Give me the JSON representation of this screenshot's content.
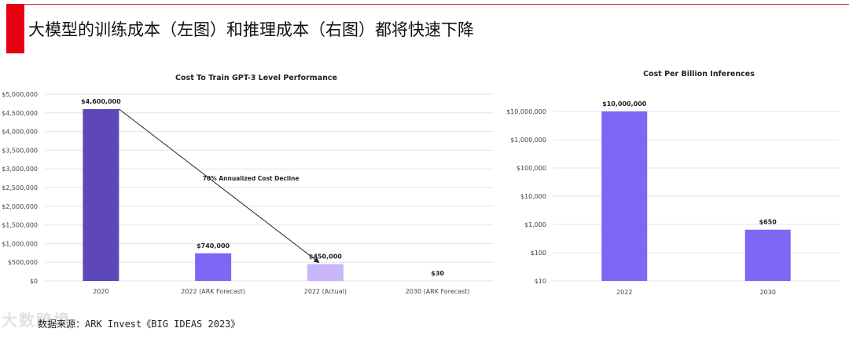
{
  "page": {
    "title": "大模型的训练成本（左图）和推理成本（右图）都将快速下降",
    "source": "数据来源：ARK Invest《BIG IDEAS 2023》",
    "watermark": "大数跨境",
    "colors": {
      "header_red": "#e60012"
    }
  },
  "chart_data": [
    {
      "type": "bar",
      "title": "Cost To Train GPT-3 Level Performance",
      "categories": [
        "2020",
        "2022 (ARK Forecast)",
        "2022 (Actual)",
        "2030 (ARK Forecast)"
      ],
      "values": [
        4600000,
        740000,
        450000,
        30
      ],
      "data_labels": [
        "$4,600,000",
        "$740,000",
        "$450,000",
        "$30"
      ],
      "bar_colors": [
        "#5e47b8",
        "#7f66f5",
        "#c8b6fb",
        "#c8b6fb"
      ],
      "ylim": [
        0,
        5000000
      ],
      "yticks": [
        0,
        500000,
        1000000,
        1500000,
        2000000,
        2500000,
        3000000,
        3500000,
        4000000,
        4500000,
        5000000
      ],
      "ytick_labels": [
        "$0",
        "$500,000",
        "$1,000,000",
        "$1,500,000",
        "$2,000,000",
        "$2,500,000",
        "$3,000,000",
        "$3,500,000",
        "$4,000,000",
        "$4,500,000",
        "$5,000,000"
      ],
      "xlabel": "",
      "ylabel": "",
      "grid": true,
      "annotation": "70% Annualized Cost Decline"
    },
    {
      "type": "bar",
      "title": "Cost Per Billion Inferences",
      "categories": [
        "2022",
        "2030"
      ],
      "values": [
        10000000,
        650
      ],
      "data_labels": [
        "$10,000,000",
        "$650"
      ],
      "bar_colors": [
        "#7f66f5",
        "#7f66f5"
      ],
      "scale": "log",
      "ylim": [
        10,
        10000000
      ],
      "yticks": [
        10,
        100,
        1000,
        10000,
        100000,
        1000000,
        10000000
      ],
      "ytick_labels": [
        "$10",
        "$100",
        "$1,000",
        "$10,000",
        "$100,000",
        "$1,000,000",
        "$10,000,000"
      ],
      "xlabel": "",
      "ylabel": "",
      "grid": true
    }
  ]
}
